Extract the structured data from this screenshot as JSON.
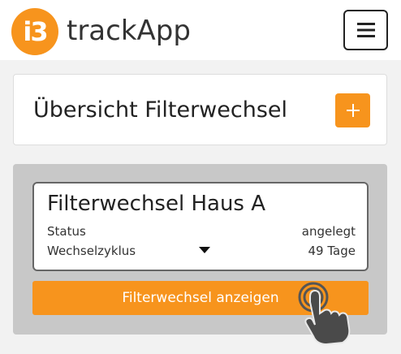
{
  "header": {
    "logo_text": "i3",
    "app_name": "trackApp"
  },
  "overview": {
    "title": "Übersicht Filterwechsel",
    "add_label": "+"
  },
  "filter_card": {
    "title": "Filterwechsel Haus A",
    "status_label": "Status",
    "status_value": "angelegt",
    "cycle_label": "Wechselzyklus",
    "cycle_value": "49 Tage"
  },
  "actions": {
    "show_label": "Filterwechsel anzeigen"
  },
  "icons": {
    "menu": "hamburger-icon",
    "add": "plus-icon",
    "caret": "caret-down-icon",
    "pointer": "tap-hand-icon"
  },
  "colors": {
    "accent": "#f7941d",
    "panel": "#c8c8c8",
    "background": "#f2f2f2"
  }
}
